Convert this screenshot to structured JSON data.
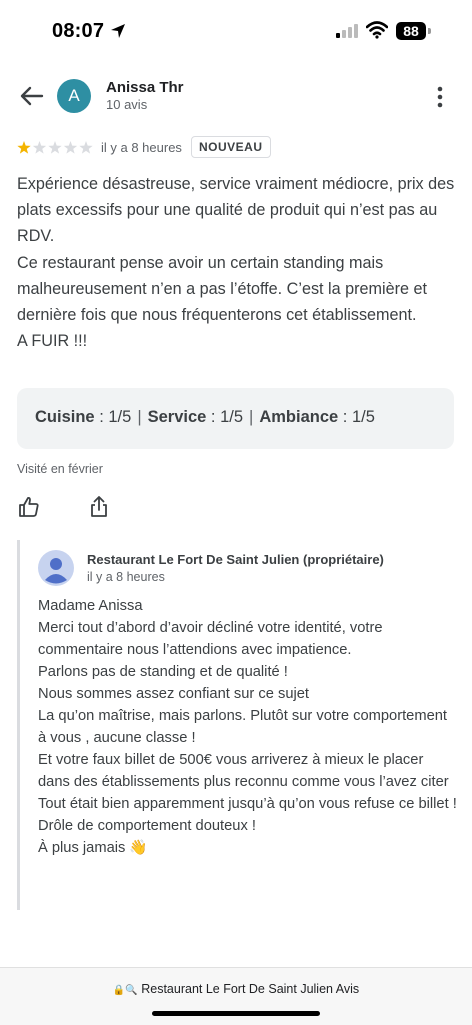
{
  "status_bar": {
    "time": "08:07",
    "battery": "88"
  },
  "review": {
    "author_initial": "A",
    "author_name": "Anissa Thr",
    "author_meta": "10 avis",
    "rating": 1,
    "rating_max": 5,
    "time_ago": "il y a 8 heures",
    "badge": "NOUVEAU",
    "text_lines": [
      "Expérience désastreuse, service vraiment médiocre, prix des plats excessifs pour une qualité de produit qui n’est pas au RDV.",
      "Ce restaurant pense avoir un certain standing mais malheureusement n’en a pas l’étoffe. C’est la première et dernière fois que nous fréquenterons cet établissement.",
      "A FUIR !!!"
    ],
    "scores": {
      "cuisine_label": "Cuisine",
      "cuisine_value": "1/5",
      "service_label": "Service",
      "service_value": "1/5",
      "ambiance_label": "Ambiance",
      "ambiance_value": "1/5"
    },
    "visited": "Visité en février"
  },
  "owner_reply": {
    "name": "Restaurant Le Fort De Saint Julien (propriétaire)",
    "time_ago": "il y a 8 heures",
    "lines": [
      "Madame Anissa",
      "Merci tout d’abord d’avoir décliné votre identité, votre commentaire nous l’attendions avec impatience.",
      "Parlons pas de standing et de qualité !",
      "Nous sommes assez confiant sur ce sujet",
      "La qu’on maîtrise, mais parlons. Plutôt sur votre comportement à vous , aucune classe !",
      "Et votre faux billet de 500€ vous arriverez à mieux le placer dans des établissements plus reconnu comme vous l’avez citer",
      "Tout était bien apparemment jusqu’à qu’on vous refuse ce billet !",
      "Drôle de comportement douteux !",
      "À plus jamais 👋"
    ]
  },
  "bottom_bar": {
    "url_text": "Restaurant Le Fort De Saint Julien Avis"
  },
  "colors": {
    "accent_avatar": "#2e8fa3",
    "star_filled": "#f4b400",
    "star_empty": "#dadce0"
  }
}
